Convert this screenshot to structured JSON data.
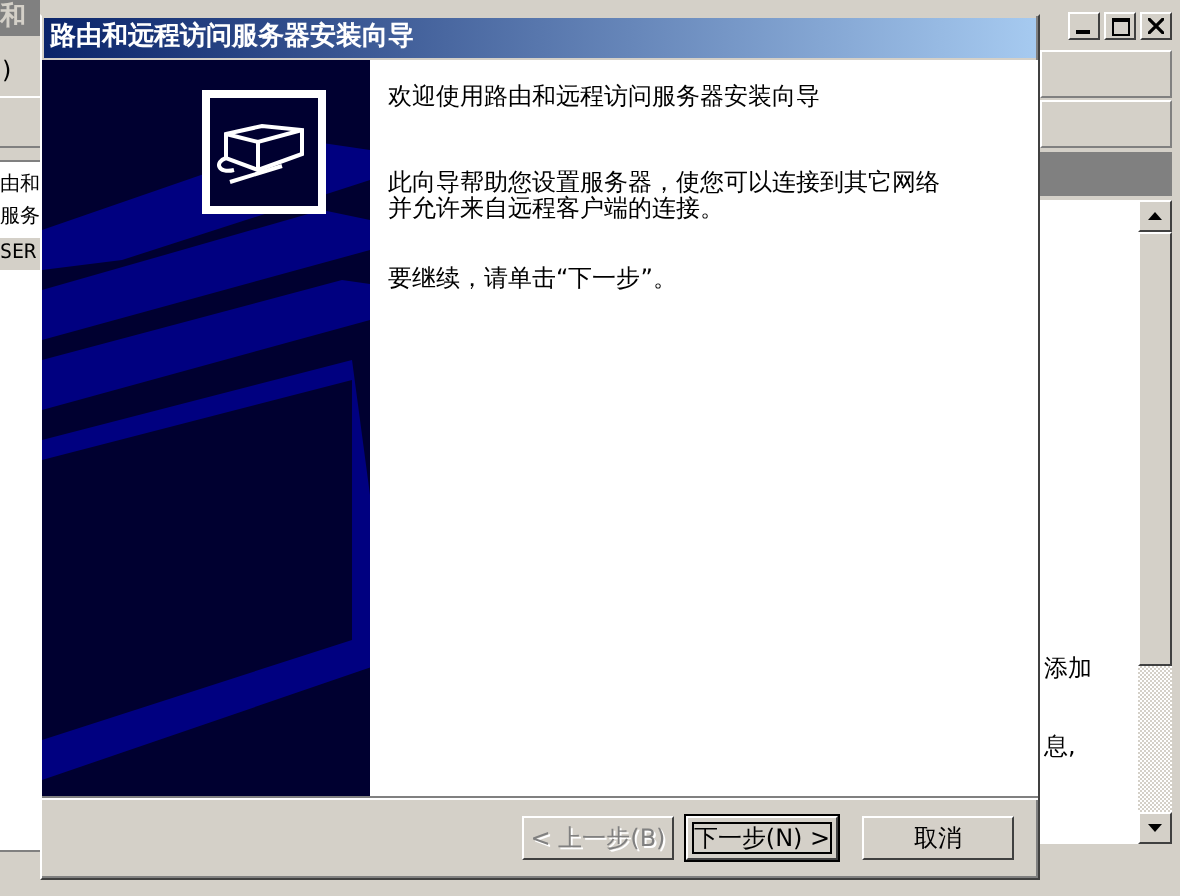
{
  "background_window": {
    "title": "和",
    "menu": ")",
    "left_items": [
      {
        "label": "由和",
        "selected": false
      },
      {
        "label": "服务",
        "selected": false
      },
      {
        "label": "SER",
        "selected": true
      }
    ],
    "right_texts": [
      "添加",
      "息,"
    ]
  },
  "dialog": {
    "title": "路由和远程访问服务器安装向导",
    "heading": "欢迎使用路由和远程访问服务器安装向导",
    "paragraphs": [
      {
        "lines": [
          "此向导帮助您设置服务器，使您可以连接到其它网络",
          "并允许来自远程客户端的连接。"
        ]
      },
      {
        "lines": [
          "要继续，请单击“下一步”。"
        ]
      }
    ],
    "buttons": [
      {
        "label": "< 上一步(B)",
        "disabled": true,
        "default": false
      },
      {
        "label": "下一步(N) >",
        "disabled": false,
        "default": true
      },
      {
        "label": "取消",
        "disabled": false,
        "default": false
      }
    ]
  }
}
